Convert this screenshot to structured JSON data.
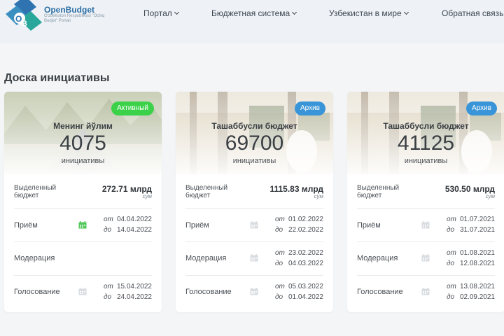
{
  "header": {
    "logo": {
      "title": "OpenBudget",
      "subtitle": "O'zbekiston Respublikasi \"Ochiq Budjet\" Portali"
    },
    "nav": [
      {
        "label": "Портал"
      },
      {
        "label": "Бюджетная система"
      },
      {
        "label": "Узбекистан в мире"
      },
      {
        "label": "Обратная связь"
      }
    ]
  },
  "page": {
    "title": "Доска инициативы"
  },
  "labels": {
    "budget": "Выделенный бюджет",
    "currency": "сум",
    "from": "от",
    "to": "до",
    "stage_receive": "Приём",
    "stage_moderation": "Модерация",
    "stage_voting": "Голосование",
    "initiatives": "инициативы"
  },
  "colors": {
    "active_badge": "#3bd24a",
    "archive_badge": "#3a95d8",
    "calendar_active": "#52c75a",
    "calendar_inactive": "#d9dde1"
  },
  "cards": [
    {
      "badge": "Активный",
      "name": "Менинг йўлим",
      "count": "4075",
      "budget": "272.71 млрд",
      "receive": {
        "from": "04.04.2022",
        "to": "14.04.2022"
      },
      "moderation": {
        "from": "",
        "to": ""
      },
      "voting": {
        "from": "15.04.2022",
        "to": "24.04.2022"
      }
    },
    {
      "badge": "Архив",
      "name": "Ташаббусли бюджет",
      "count": "69700",
      "budget": "1115.83 млрд",
      "receive": {
        "from": "01.02.2022",
        "to": "22.02.2022"
      },
      "moderation": {
        "from": "23.02.2022",
        "to": "04.03.2022"
      },
      "voting": {
        "from": "05.03.2022",
        "to": "01.04.2022"
      }
    },
    {
      "badge": "Архив",
      "name": "Ташаббусли бюджет",
      "count": "41125",
      "budget": "530.50 млрд",
      "receive": {
        "from": "01.07.2021",
        "to": "31.07.2021"
      },
      "moderation": {
        "from": "01.08.2021",
        "to": "12.08.2021"
      },
      "voting": {
        "from": "13.08.2021",
        "to": "02.09.2021"
      }
    }
  ]
}
